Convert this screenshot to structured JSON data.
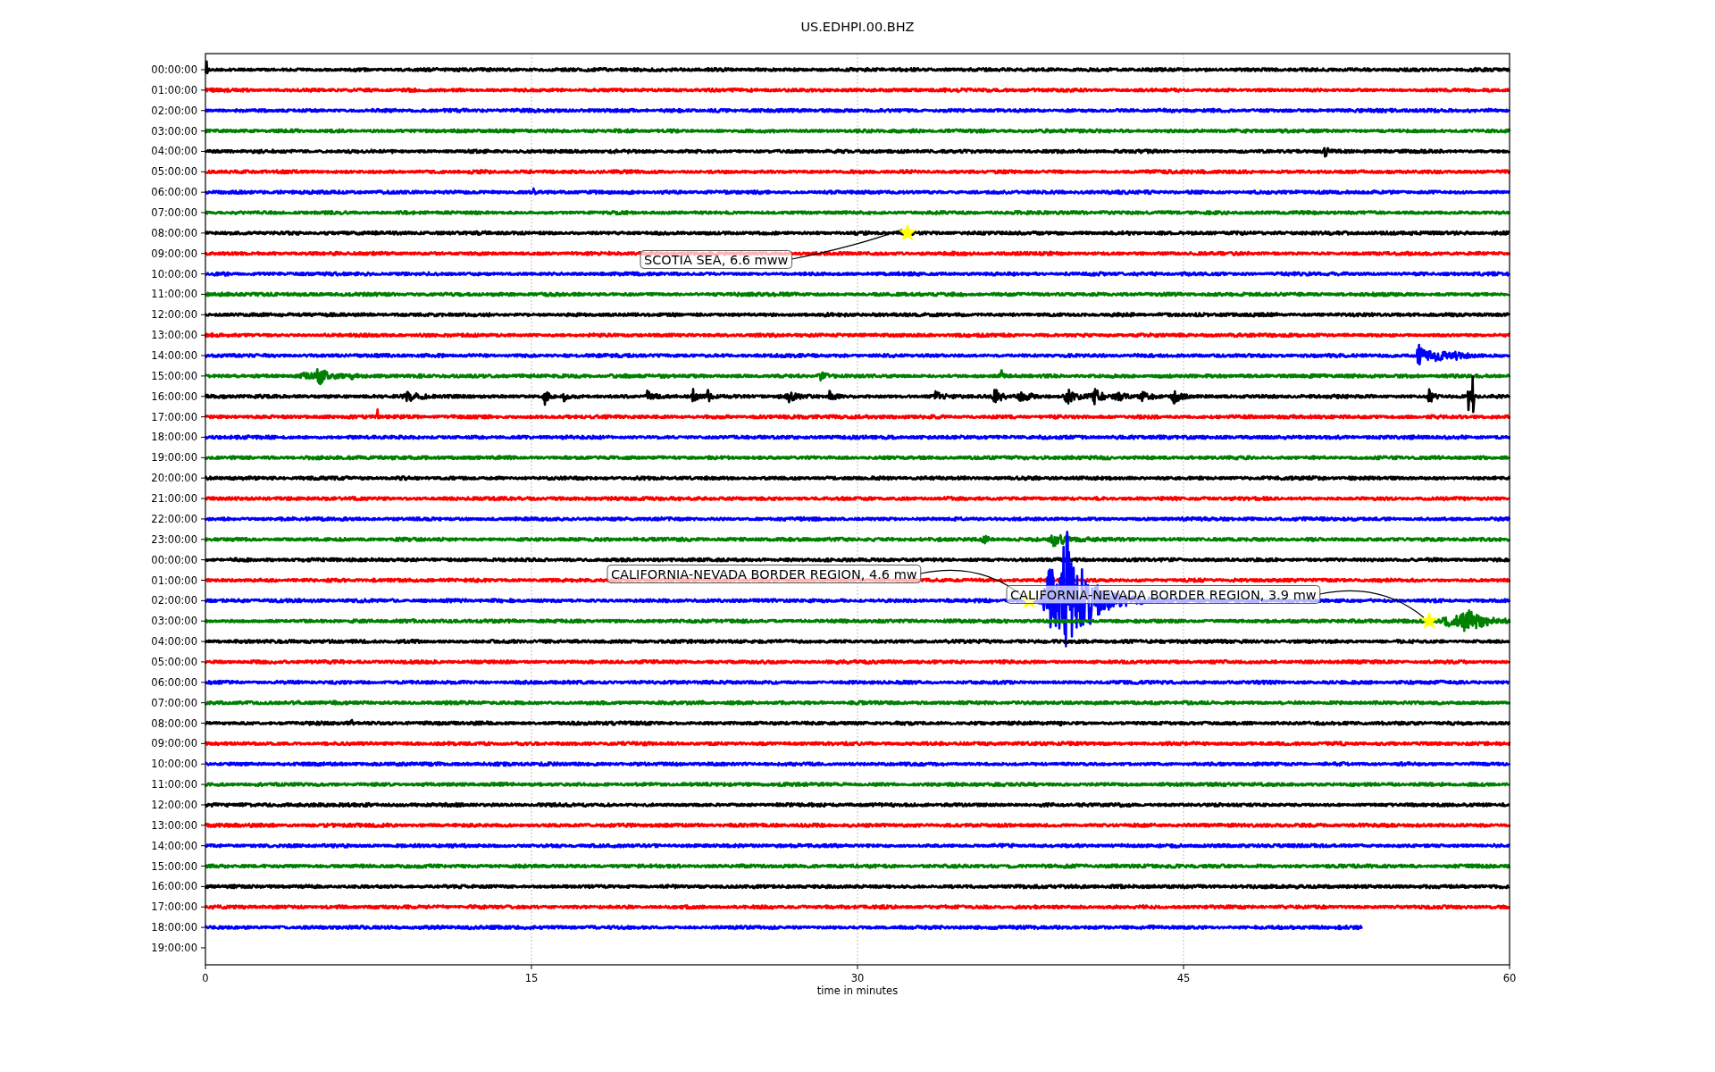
{
  "title": "US.EDHPI.00.BHZ",
  "plot": {
    "xlabel": "time in minutes",
    "xticks": [
      "0",
      "15",
      "30",
      "45",
      "60"
    ],
    "rows": [
      {
        "label": "00:00:00",
        "color": "#000000",
        "kind": "full"
      },
      {
        "label": "01:00:00",
        "color": "#ff0000",
        "kind": "full"
      },
      {
        "label": "02:00:00",
        "color": "#0000ff",
        "kind": "full"
      },
      {
        "label": "03:00:00",
        "color": "#008000",
        "kind": "full"
      },
      {
        "label": "04:00:00",
        "color": "#000000",
        "kind": "full"
      },
      {
        "label": "05:00:00",
        "color": "#ff0000",
        "kind": "full"
      },
      {
        "label": "06:00:00",
        "color": "#0000ff",
        "kind": "full"
      },
      {
        "label": "07:00:00",
        "color": "#008000",
        "kind": "full"
      },
      {
        "label": "08:00:00",
        "color": "#000000",
        "kind": "full"
      },
      {
        "label": "09:00:00",
        "color": "#ff0000",
        "kind": "full"
      },
      {
        "label": "10:00:00",
        "color": "#0000ff",
        "kind": "full"
      },
      {
        "label": "11:00:00",
        "color": "#008000",
        "kind": "full"
      },
      {
        "label": "12:00:00",
        "color": "#000000",
        "kind": "full"
      },
      {
        "label": "13:00:00",
        "color": "#ff0000",
        "kind": "full"
      },
      {
        "label": "14:00:00",
        "color": "#0000ff",
        "kind": "full"
      },
      {
        "label": "15:00:00",
        "color": "#008000",
        "kind": "full"
      },
      {
        "label": "16:00:00",
        "color": "#000000",
        "kind": "full"
      },
      {
        "label": "17:00:00",
        "color": "#ff0000",
        "kind": "full"
      },
      {
        "label": "18:00:00",
        "color": "#0000ff",
        "kind": "full"
      },
      {
        "label": "19:00:00",
        "color": "#008000",
        "kind": "full"
      },
      {
        "label": "20:00:00",
        "color": "#000000",
        "kind": "full"
      },
      {
        "label": "21:00:00",
        "color": "#ff0000",
        "kind": "full"
      },
      {
        "label": "22:00:00",
        "color": "#0000ff",
        "kind": "full"
      },
      {
        "label": "23:00:00",
        "color": "#008000",
        "kind": "full"
      },
      {
        "label": "00:00:00",
        "color": "#000000",
        "kind": "full"
      },
      {
        "label": "01:00:00",
        "color": "#ff0000",
        "kind": "full"
      },
      {
        "label": "02:00:00",
        "color": "#0000ff",
        "kind": "full"
      },
      {
        "label": "03:00:00",
        "color": "#008000",
        "kind": "full"
      },
      {
        "label": "04:00:00",
        "color": "#000000",
        "kind": "full"
      },
      {
        "label": "05:00:00",
        "color": "#ff0000",
        "kind": "full"
      },
      {
        "label": "06:00:00",
        "color": "#0000ff",
        "kind": "full"
      },
      {
        "label": "07:00:00",
        "color": "#008000",
        "kind": "full"
      },
      {
        "label": "08:00:00",
        "color": "#000000",
        "kind": "full"
      },
      {
        "label": "09:00:00",
        "color": "#ff0000",
        "kind": "full"
      },
      {
        "label": "10:00:00",
        "color": "#0000ff",
        "kind": "full"
      },
      {
        "label": "11:00:00",
        "color": "#008000",
        "kind": "full"
      },
      {
        "label": "12:00:00",
        "color": "#000000",
        "kind": "full"
      },
      {
        "label": "13:00:00",
        "color": "#ff0000",
        "kind": "full"
      },
      {
        "label": "14:00:00",
        "color": "#0000ff",
        "kind": "full"
      },
      {
        "label": "15:00:00",
        "color": "#008000",
        "kind": "full"
      },
      {
        "label": "16:00:00",
        "color": "#000000",
        "kind": "full"
      },
      {
        "label": "17:00:00",
        "color": "#ff0000",
        "kind": "full"
      },
      {
        "label": "18:00:00",
        "color": "#0000ff",
        "kind": "partial"
      },
      {
        "label": "19:00:00",
        "kind": "empty"
      }
    ],
    "events": [
      {
        "text": "SCOTIA SEA, 6.6 mww"
      },
      {
        "text": "CALIFORNIA-NEVADA BORDER REGION, 4.6 mw"
      },
      {
        "text": "CALIFORNIA-NEVADA BORDER REGION, 3.9 mw"
      }
    ]
  }
}
